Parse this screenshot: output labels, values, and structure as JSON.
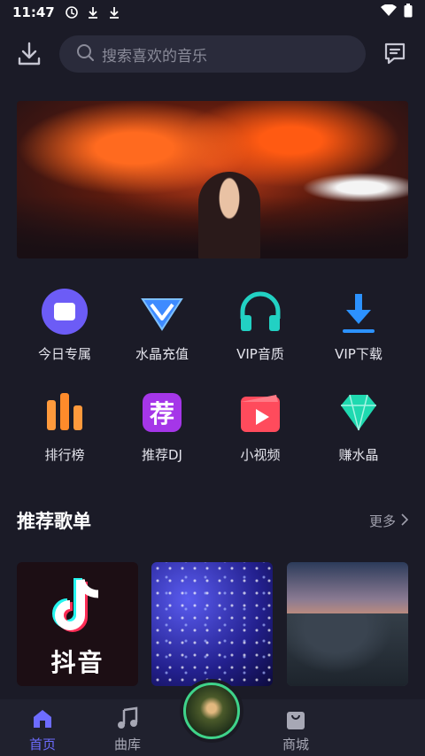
{
  "status_bar": {
    "time": "11:47"
  },
  "search": {
    "placeholder": "搜索喜欢的音乐"
  },
  "features": [
    {
      "label": "今日专属",
      "icon": "today-exclusive-icon"
    },
    {
      "label": "水晶充值",
      "icon": "crystal-recharge-icon"
    },
    {
      "label": "VIP音质",
      "icon": "headphones-icon"
    },
    {
      "label": "VIP下载",
      "icon": "download-icon"
    },
    {
      "label": "排行榜",
      "icon": "ranking-icon"
    },
    {
      "label": "推荐DJ",
      "icon": "recommend-icon"
    },
    {
      "label": "小视频",
      "icon": "video-icon"
    },
    {
      "label": "赚水晶",
      "icon": "diamond-icon"
    }
  ],
  "section": {
    "title": "推荐歌单",
    "more_label": "更多"
  },
  "cards": [
    {
      "label": "抖音"
    }
  ],
  "nav": {
    "home": "首页",
    "library": "曲库",
    "shop": "商城"
  },
  "colors": {
    "background": "#1b1b27",
    "accent": "#6d6cff",
    "search_bg": "#2a2b3b"
  }
}
